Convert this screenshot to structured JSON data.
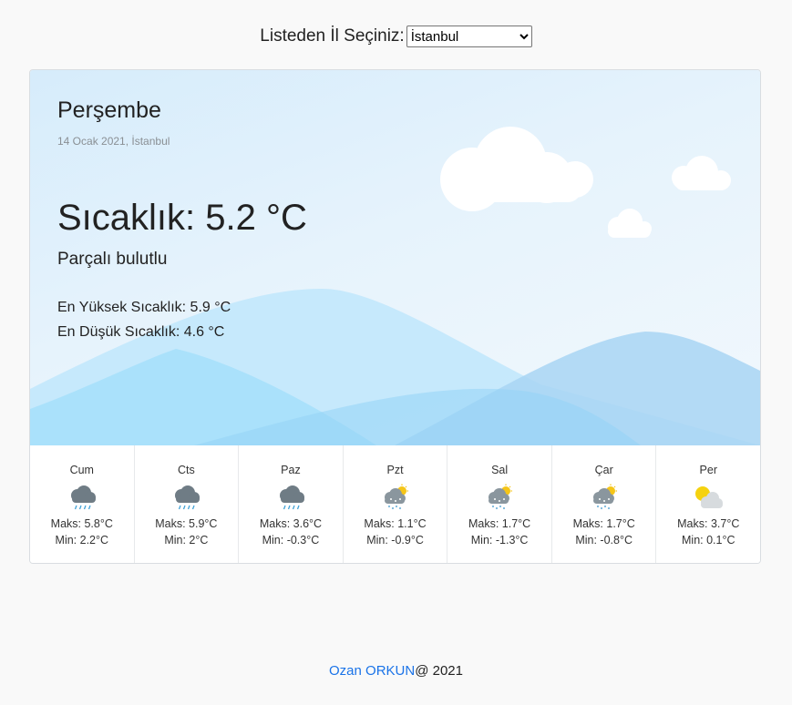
{
  "selector": {
    "label": "Listeden İl Seçiniz:",
    "selected": "İstanbul"
  },
  "current": {
    "day_name": "Perşembe",
    "date_line": "14 Ocak 2021, İstanbul",
    "temperature": "Sıcaklık: 5.2 °C",
    "description": "Parçalı bulutlu",
    "max_line": "En Yüksek Sıcaklık: 5.9 °C",
    "min_line": "En Düşük Sıcaklık: 4.6 °C"
  },
  "forecast": [
    {
      "day": "Cum",
      "icon": "rain-cloud-icon",
      "max": "Maks: 5.8°C",
      "min": "Min: 2.2°C"
    },
    {
      "day": "Cts",
      "icon": "rain-cloud-icon",
      "max": "Maks: 5.9°C",
      "min": "Min: 2°C"
    },
    {
      "day": "Paz",
      "icon": "rain-cloud-icon",
      "max": "Maks: 3.6°C",
      "min": "Min: -0.3°C"
    },
    {
      "day": "Pzt",
      "icon": "snow-sun-cloud-icon",
      "max": "Maks: 1.1°C",
      "min": "Min: -0.9°C"
    },
    {
      "day": "Sal",
      "icon": "snow-sun-cloud-icon",
      "max": "Maks: 1.7°C",
      "min": "Min: -1.3°C"
    },
    {
      "day": "Çar",
      "icon": "snow-sun-cloud-icon",
      "max": "Maks: 1.7°C",
      "min": "Min: -0.8°C"
    },
    {
      "day": "Per",
      "icon": "partly-cloudy-icon",
      "max": "Maks: 3.7°C",
      "min": "Min: 0.1°C"
    }
  ],
  "footer": {
    "author": "Ozan ORKUN",
    "suffix": "@ 2021"
  },
  "colors": {
    "link": "#1a73e8",
    "sky": "#e6f3fc",
    "mountain": "#9fdcf8"
  }
}
